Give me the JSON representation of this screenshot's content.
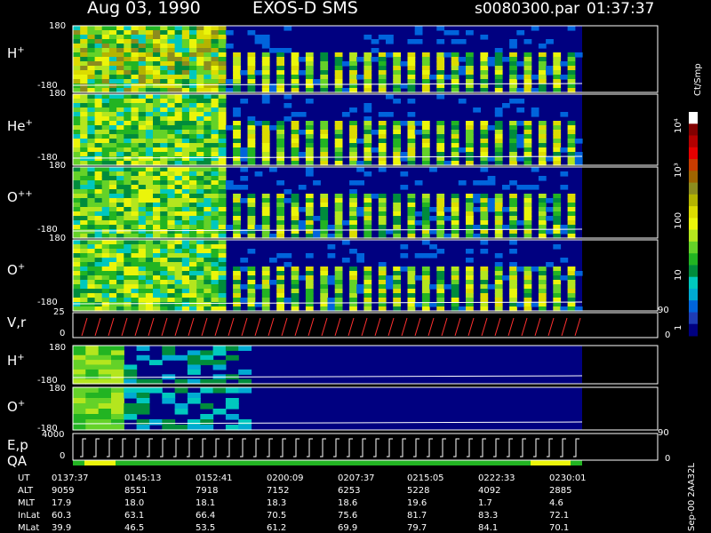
{
  "header": {
    "date": "Aug 03, 1990",
    "instrument": "EXOS-D SMS",
    "file": "s0080300.par",
    "time": "01:37:37"
  },
  "panels": [
    {
      "label": "H+",
      "label_main": "H",
      "label_sup": "+",
      "tick_top": "180",
      "tick_bottom": "-180",
      "kind": "wave"
    },
    {
      "label": "He+",
      "label_main": "He",
      "label_sup": "+",
      "tick_top": "180",
      "tick_bottom": "-180",
      "kind": "wave"
    },
    {
      "label": "O++",
      "label_main": "O",
      "label_sup": "++",
      "tick_top": "180",
      "tick_bottom": "-180",
      "kind": "wave"
    },
    {
      "label": "O+",
      "label_main": "O",
      "label_sup": "+",
      "tick_top": "180",
      "tick_bottom": "-180",
      "kind": "wave"
    },
    {
      "label": "V,r",
      "label_main": "V,r",
      "label_sup": "",
      "tick_top": "25",
      "tick_bottom": "0",
      "right_top": "90",
      "right_bottom": "0",
      "kind": "line"
    },
    {
      "label": "H+",
      "label_main": "H",
      "label_sup": "+",
      "tick_top": "180",
      "tick_bottom": "-180",
      "kind": "flat"
    },
    {
      "label": "O+",
      "label_main": "O",
      "label_sup": "+",
      "tick_top": "180",
      "tick_bottom": "-180",
      "kind": "flat"
    },
    {
      "label": "E,p",
      "label_main": "E,p",
      "label_sup": "",
      "tick_top": "4000",
      "tick_bottom": "0",
      "right_top": "90",
      "right_bottom": "0",
      "label2": "QA",
      "kind": "ep"
    }
  ],
  "colorbar": {
    "unit": "Ct/Smp",
    "ticks": [
      "1",
      "10",
      "100",
      "10³",
      "10⁴"
    ],
    "colors": [
      "#000080",
      "#1e3cb4",
      "#0064dc",
      "#00aad2",
      "#00c8be",
      "#008c3c",
      "#22b422",
      "#64d228",
      "#b4e61e",
      "#ebf50a",
      "#dcdc00",
      "#b4b400",
      "#8c8c1e",
      "#a06400",
      "#c83c00",
      "#e60000",
      "#b40000",
      "#820000",
      "#ffffff"
    ]
  },
  "footer": {
    "rows": [
      {
        "label": "UT",
        "values": [
          "0137:37",
          "0145:13",
          "0152:41",
          "0200:09",
          "0207:37",
          "0215:05",
          "0222:33",
          "0230:01"
        ]
      },
      {
        "label": "ALT",
        "values": [
          "9059",
          "8551",
          "7918",
          "7152",
          "6253",
          "5228",
          "4092",
          "2885"
        ]
      },
      {
        "label": "MLT",
        "values": [
          "17.9",
          "18.0",
          "18.1",
          "18.3",
          "18.6",
          "19.6",
          "1.7",
          "4.6"
        ]
      },
      {
        "label": "InLat",
        "values": [
          "60.3",
          "63.1",
          "66.4",
          "70.5",
          "75.6",
          "81.7",
          "83.3",
          "72.1"
        ]
      },
      {
        "label": "MLat",
        "values": [
          "39.9",
          "46.5",
          "53.5",
          "61.2",
          "69.9",
          "79.7",
          "84.1",
          "70.1"
        ]
      }
    ],
    "side_stamp": "Sep-00 2AA32L"
  },
  "chart_data": {
    "type": "heatmap",
    "x_ticks_ut": [
      "0137:37",
      "0145:13",
      "0152:41",
      "0200:09",
      "0207:37",
      "0215:05",
      "0222:33",
      "0230:01"
    ],
    "series": [
      {
        "name": "H+",
        "ylim": [
          -180,
          180
        ]
      },
      {
        "name": "He+",
        "ylim": [
          -180,
          180
        ]
      },
      {
        "name": "O++",
        "ylim": [
          -180,
          180
        ]
      },
      {
        "name": "O+",
        "ylim": [
          -180,
          180
        ]
      },
      {
        "name": "V,r",
        "ylim": [
          0,
          25
        ],
        "ylim_right": [
          0,
          90
        ]
      },
      {
        "name": "H+",
        "ylim": [
          -180,
          180
        ]
      },
      {
        "name": "O+",
        "ylim": [
          -180,
          180
        ]
      },
      {
        "name": "E,p",
        "ylim": [
          0,
          4000
        ],
        "ylim_right": [
          0,
          90
        ]
      }
    ],
    "color_scale": {
      "label": "Ct/Smp",
      "log": true,
      "range": [
        1,
        10000
      ]
    }
  }
}
